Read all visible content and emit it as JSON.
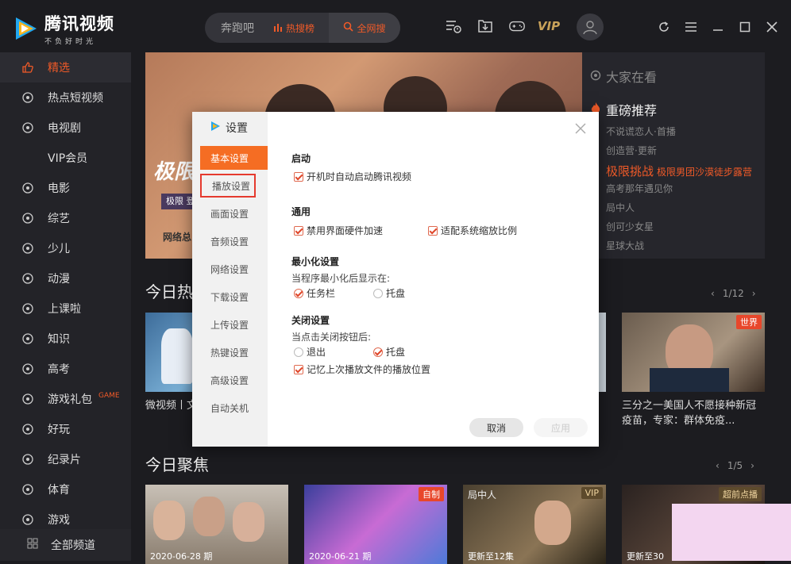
{
  "app": {
    "name": "腾讯视频",
    "slogan": "不负好时光"
  },
  "search": {
    "hot_term": "奔跑吧",
    "trending_label": "热搜榜",
    "search_all_label": "全网搜"
  },
  "toolbar": {
    "vip_label": "VIP"
  },
  "sidebar": {
    "items": [
      {
        "label": "精选",
        "icon": "thumbs-up-icon",
        "active": true
      },
      {
        "label": "热点短视频",
        "icon": "flame-icon"
      },
      {
        "label": "电视剧",
        "icon": "tv-icon"
      },
      {
        "label": "VIP会员",
        "icon": "vip-icon"
      },
      {
        "label": "电影",
        "icon": "film-reel-icon"
      },
      {
        "label": "综艺",
        "icon": "microphone-icon"
      },
      {
        "label": "少儿",
        "icon": "kids-icon"
      },
      {
        "label": "动漫",
        "icon": "bear-icon"
      },
      {
        "label": "上课啦",
        "icon": "graduation-cap-icon"
      },
      {
        "label": "知识",
        "icon": "book-icon"
      },
      {
        "label": "高考",
        "icon": "house-icon"
      },
      {
        "label": "游戏礼包",
        "icon": "gamepad-icon",
        "badge": "GAME"
      },
      {
        "label": "好玩",
        "icon": "joystick-icon"
      },
      {
        "label": "纪录片",
        "icon": "camera-icon"
      },
      {
        "label": "体育",
        "icon": "ball-icon"
      },
      {
        "label": "游戏",
        "icon": "game-icon"
      }
    ],
    "all_channels": "全部频道"
  },
  "banner": {
    "title": "极限",
    "caption": "极限 登顶",
    "net_text": "网络总"
  },
  "right_panel": {
    "watching_label": "大家在看",
    "recommend_label": "重磅推荐",
    "items": [
      {
        "text": "不说谎恋人·首播",
        "highlight": false
      },
      {
        "text": "创造营·更新",
        "highlight": false
      },
      {
        "text": "极限挑战",
        "sub": "极限男团沙漠徒步露营",
        "highlight": true
      },
      {
        "text": "高考那年遇见你",
        "highlight": false
      },
      {
        "text": "局中人",
        "highlight": false
      },
      {
        "text": "创可少女星",
        "highlight": false
      },
      {
        "text": "星球大战",
        "highlight": false
      }
    ]
  },
  "section_hot": {
    "title": "今日热",
    "pager": "1/12",
    "cards": [
      {
        "text": "微视频丨文 向“豁出",
        "badge": ""
      },
      {
        "text": "三分之一美国人不愿接种新冠疫苗，专家：群体免疫...",
        "badge": "世界"
      }
    ]
  },
  "section_focus": {
    "title": "今日聚焦",
    "pager": "1/5",
    "cards": [
      {
        "date": "2020-06-28 期",
        "badge": ""
      },
      {
        "date": "2020-06-21 期",
        "badge": "自制"
      },
      {
        "date": "更新至12集",
        "badge": "VIP",
        "overlay": "局中人"
      },
      {
        "date": "更新至30",
        "badge": "超前点播"
      }
    ]
  },
  "dialog": {
    "title": "设置",
    "nav": [
      "基本设置",
      "播放设置",
      "画面设置",
      "音频设置",
      "网络设置",
      "下载设置",
      "上传设置",
      "热键设置",
      "高级设置",
      "自动关机"
    ],
    "startup": {
      "title": "启动",
      "opt1": "开机时自动启动腾讯视频"
    },
    "general": {
      "title": "通用",
      "opt1": "禁用界面硬件加速",
      "opt2": "适配系统缩放比例"
    },
    "minimize": {
      "title": "最小化设置",
      "desc": "当程序最小化后显示在:",
      "r1": "任务栏",
      "r2": "托盘"
    },
    "close": {
      "title": "关闭设置",
      "desc": "当点击关闭按钮后:",
      "r1": "退出",
      "r2": "托盘",
      "opt1": "记忆上次播放文件的播放位置"
    },
    "cancel_label": "取消",
    "apply_label": "应用"
  },
  "colors": {
    "accent": "#f05a28",
    "sidebar_bg": "#232328",
    "dialog_nav_active": "#f56d23"
  }
}
